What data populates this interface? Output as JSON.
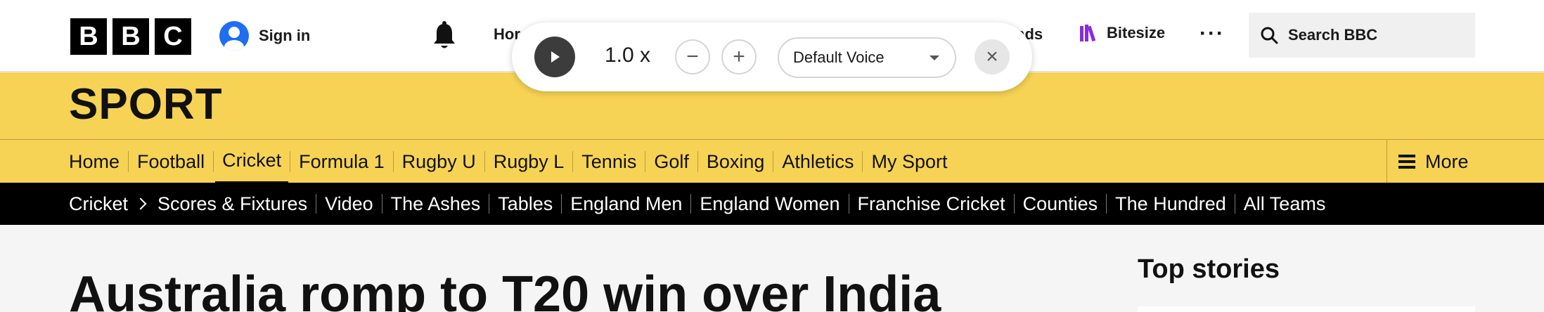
{
  "masthead": {
    "logo_letters": [
      "B",
      "B",
      "C"
    ],
    "sign_in_label": "Sign in",
    "nav_home_partial": "Hor",
    "nav_partial_right": "nds",
    "bitesize_label": "Bitesize",
    "more_dots": "···",
    "search_placeholder": "Search BBC"
  },
  "player": {
    "speed_label": "1.0 x",
    "decrease_label": "−",
    "increase_label": "+",
    "voice_label": "Default Voice",
    "close_label": "×"
  },
  "sport": {
    "title": "SPORT"
  },
  "primary_nav": {
    "items": [
      {
        "label": "Home"
      },
      {
        "label": "Football"
      },
      {
        "label": "Cricket",
        "active": true
      },
      {
        "label": "Formula 1"
      },
      {
        "label": "Rugby U"
      },
      {
        "label": "Rugby L"
      },
      {
        "label": "Tennis"
      },
      {
        "label": "Golf"
      },
      {
        "label": "Boxing"
      },
      {
        "label": "Athletics"
      },
      {
        "label": "My Sport"
      }
    ],
    "more_label": "More"
  },
  "secondary_nav": {
    "section": "Cricket",
    "items": [
      {
        "label": "Scores & Fixtures"
      },
      {
        "label": "Video"
      },
      {
        "label": "The Ashes"
      },
      {
        "label": "Tables"
      },
      {
        "label": "England Men"
      },
      {
        "label": "England Women"
      },
      {
        "label": "Franchise Cricket"
      },
      {
        "label": "Counties"
      },
      {
        "label": "The Hundred"
      },
      {
        "label": "All Teams"
      }
    ]
  },
  "article": {
    "headline": "Australia romp to T20 win over India"
  },
  "sidebar": {
    "top_stories_title": "Top stories"
  },
  "colors": {
    "sport_yellow": "#f6d354",
    "signin_blue": "#1d6ef0",
    "bitesize_purple": "#8a2be2"
  }
}
